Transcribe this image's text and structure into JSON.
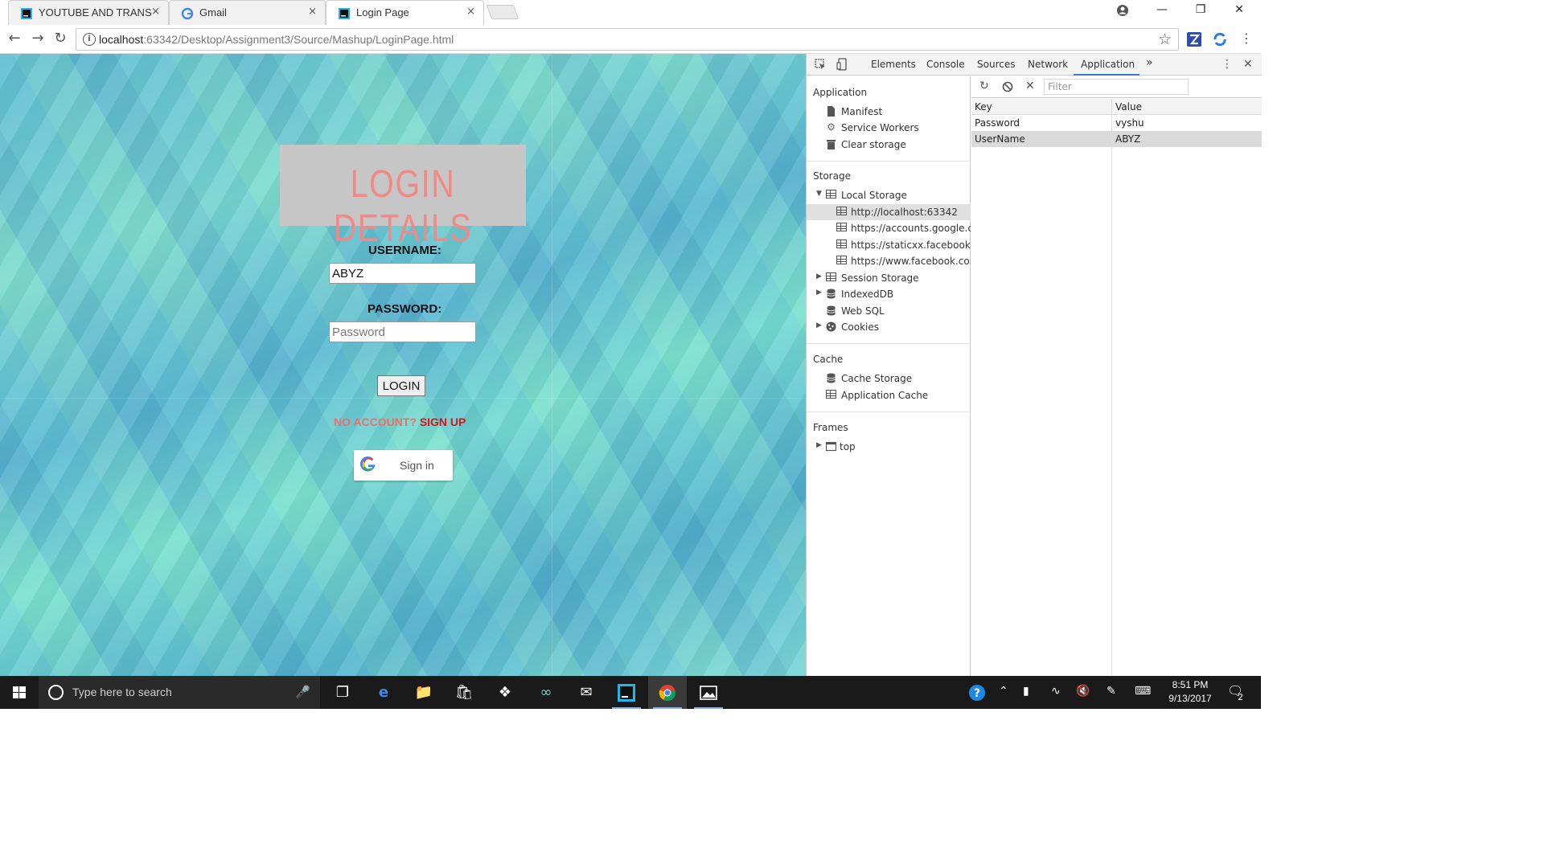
{
  "browser": {
    "tabs": [
      {
        "title": "YOUTUBE AND TRANSLA",
        "icon": "webstorm-icon",
        "active": false
      },
      {
        "title": "Gmail",
        "icon": "google-g-icon",
        "active": false
      },
      {
        "title": "Login Page",
        "icon": "webstorm-icon",
        "active": true
      }
    ],
    "close_glyph": "×",
    "url_host": "localhost",
    "url_rest": ":63342/Desktop/Assignment3/Source/Mashup/LoginPage.html",
    "window_controls": {
      "minimize": "—",
      "restore": "❐",
      "close": "✕"
    }
  },
  "page": {
    "banner_title": "LOGIN DETAILS",
    "username_label": "USERNAME:",
    "username_value": "ABYZ",
    "password_label": "PASSWORD:",
    "password_placeholder": "Password",
    "login_button": "LOGIN",
    "no_account_text": "NO ACCOUNT?",
    "sign_up_text": "SIGN UP",
    "google_signin_label": "Sign in"
  },
  "devtools": {
    "tabs": [
      "Elements",
      "Console",
      "Sources",
      "Network",
      "Application"
    ],
    "active_tab": "Application",
    "more_tabs": "»",
    "sidebar": {
      "application": {
        "title": "Application",
        "items": [
          {
            "label": "Manifest",
            "icon": "file-icon"
          },
          {
            "label": "Service Workers",
            "icon": "gear-icon"
          },
          {
            "label": "Clear storage",
            "icon": "trash-icon"
          }
        ]
      },
      "storage": {
        "title": "Storage",
        "local_storage": "Local Storage",
        "origins": [
          "http://localhost:63342",
          "https://accounts.google.com",
          "https://staticxx.facebook.com",
          "https://www.facebook.com"
        ],
        "selected_origin": "http://localhost:63342",
        "session_storage": "Session Storage",
        "indexeddb": "IndexedDB",
        "websql": "Web SQL",
        "cookies": "Cookies"
      },
      "cache": {
        "title": "Cache",
        "items": [
          "Cache Storage",
          "Application Cache"
        ]
      },
      "frames": {
        "title": "Frames",
        "items": [
          "top"
        ]
      }
    },
    "filter_placeholder": "Filter",
    "table": {
      "headers": {
        "key": "Key",
        "value": "Value"
      },
      "rows": [
        {
          "key": "Password",
          "value": "vyshu",
          "selected": false
        },
        {
          "key": "UserName",
          "value": "ABYZ",
          "selected": true
        }
      ]
    }
  },
  "taskbar": {
    "search_placeholder": "Type here to search",
    "time": "8:51 PM",
    "date": "9/13/2017",
    "notification_count": "2"
  },
  "colors": {
    "banner_text": "#ef8a86",
    "sign_up": "#e0101a",
    "no_account": "#f26b6b",
    "devtools_accent": "#3879d9"
  }
}
